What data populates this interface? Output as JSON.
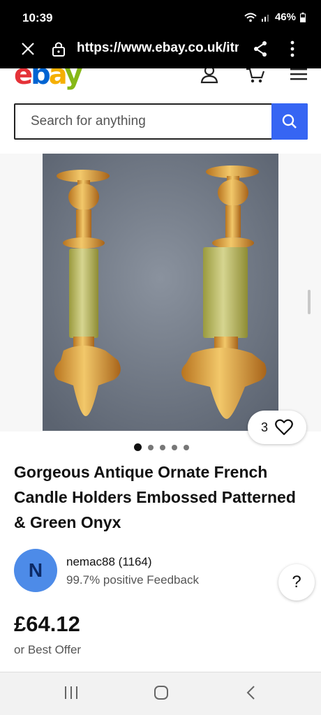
{
  "status_bar": {
    "time": "10:39",
    "battery": "46%"
  },
  "browser": {
    "url": "https://www.ebay.co.uk/itm"
  },
  "header": {
    "logo_letters": [
      "e",
      "b",
      "a",
      "y"
    ]
  },
  "search": {
    "placeholder": "Search for anything"
  },
  "listing": {
    "watch_count": "3",
    "image_count": 5,
    "active_image": 0,
    "title": "Gorgeous Antique Ornate French Candle Holders Embossed Patterned & Green Onyx",
    "seller": {
      "avatar_letter": "N",
      "name": "nemac88 (1164)",
      "feedback": "99.7% positive Feedback"
    },
    "help": "?",
    "price": "£64.12",
    "best_offer": "or Best Offer"
  },
  "colors": {
    "accent": "#3665f3",
    "avatar": "#4d8be8",
    "logo_e": "#e53238",
    "logo_b": "#0064d2",
    "logo_a": "#f5af02",
    "logo_y": "#86b817"
  }
}
